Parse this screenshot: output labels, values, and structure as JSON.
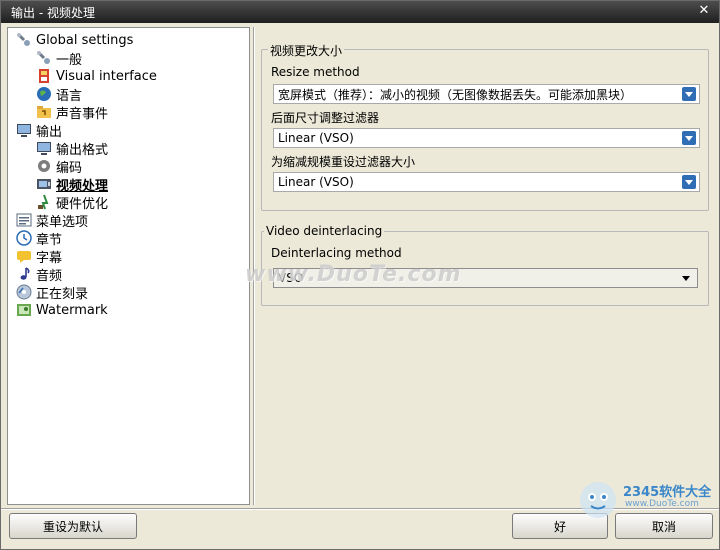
{
  "window": {
    "title": "输出 - 视频处理",
    "close_glyph": "✕"
  },
  "tree": [
    {
      "label": "Global settings",
      "icon": "tools-icon",
      "level": 0,
      "selected": false
    },
    {
      "label": "一般",
      "icon": "tools-icon",
      "level": 1,
      "selected": false
    },
    {
      "label": "Visual interface",
      "icon": "paint-icon",
      "level": 1,
      "selected": false
    },
    {
      "label": "语言",
      "icon": "globe-icon",
      "level": 1,
      "selected": false
    },
    {
      "label": "声音事件",
      "icon": "sound-folder-icon",
      "level": 1,
      "selected": false
    },
    {
      "label": "输出",
      "icon": "monitor-icon",
      "level": 0,
      "selected": false
    },
    {
      "label": "输出格式",
      "icon": "monitor-icon",
      "level": 1,
      "selected": false
    },
    {
      "label": "编码",
      "icon": "gear-icon",
      "level": 1,
      "selected": false
    },
    {
      "label": "视频处理",
      "icon": "video-icon",
      "level": 1,
      "selected": true
    },
    {
      "label": "硬件优化",
      "icon": "hardware-icon",
      "level": 1,
      "selected": false
    },
    {
      "label": "菜单选项",
      "icon": "menu-icon",
      "level": 0,
      "selected": false
    },
    {
      "label": "章节",
      "icon": "clock-icon",
      "level": 0,
      "selected": false
    },
    {
      "label": "字幕",
      "icon": "subtitle-icon",
      "level": 0,
      "selected": false
    },
    {
      "label": "音频",
      "icon": "music-note-icon",
      "level": 0,
      "selected": false
    },
    {
      "label": "正在刻录",
      "icon": "disc-icon",
      "level": 0,
      "selected": false
    },
    {
      "label": "Watermark",
      "icon": "watermark-icon",
      "level": 0,
      "selected": false
    }
  ],
  "resize_group": {
    "legend": "视频更改大小",
    "resize_method_label": "Resize method",
    "resize_method_value": "宽屏模式（推荐）：减小的视频（无图像数据丢失。可能添加黑块）",
    "post_filter_label": "后面尺寸调整过滤器",
    "post_filter_value": "Linear (VSO)",
    "reduce_filter_label": "为缩减规模重设过滤器大小",
    "reduce_filter_value": "Linear (VSO)"
  },
  "deinterlace_group": {
    "legend": "Video deinterlacing",
    "method_label": "Deinterlacing method",
    "method_value": "VSO"
  },
  "buttons": {
    "reset": "重设为默认",
    "ok": "好",
    "cancel": "取消"
  },
  "watermark_text": "www.DuoTe.com",
  "corner_logo": {
    "brand": "2345软件大全",
    "url": "www.DuoTe.com"
  }
}
